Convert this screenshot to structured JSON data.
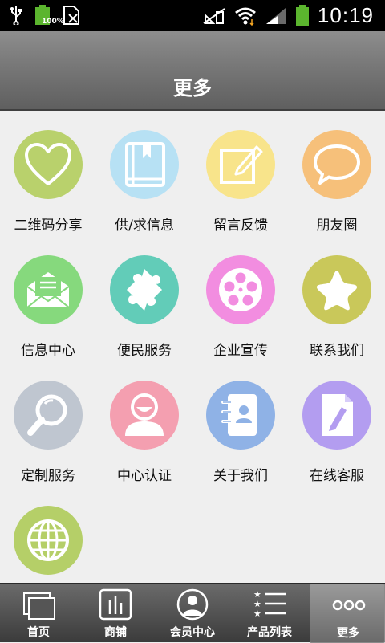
{
  "status_bar": {
    "time": "10:19",
    "battery_level_label": "100%"
  },
  "header": {
    "title": "更多"
  },
  "tiles": [
    {
      "label": "二维码分享",
      "icon": "heart-icon",
      "color": "#b9d16c"
    },
    {
      "label": "供/求信息",
      "icon": "book-icon",
      "color": "#b7e1f4"
    },
    {
      "label": "留言反馈",
      "icon": "edit-icon",
      "color": "#f8e48b"
    },
    {
      "label": "朋友圈",
      "icon": "chat-bubble-icon",
      "color": "#f6c07a"
    },
    {
      "label": "信息中心",
      "icon": "envelope-icon",
      "color": "#86d97d"
    },
    {
      "label": "便民服务",
      "icon": "puzzle-icon",
      "color": "#62ccb8"
    },
    {
      "label": "企业宣传",
      "icon": "film-reel-icon",
      "color": "#f28de0"
    },
    {
      "label": "联系我们",
      "icon": "star-icon",
      "color": "#c9c85a"
    },
    {
      "label": "定制服务",
      "icon": "magnifier-icon",
      "color": "#bfc6d0"
    },
    {
      "label": "中心认证",
      "icon": "user-icon",
      "color": "#f49fb0"
    },
    {
      "label": "关于我们",
      "icon": "contacts-book-icon",
      "color": "#8fb2e6"
    },
    {
      "label": "在线客服",
      "icon": "document-pen-icon",
      "color": "#b39df0"
    },
    {
      "label": "",
      "icon": "globe-icon",
      "color": "#b5cf68"
    }
  ],
  "tabbar": {
    "items": [
      {
        "label": "首页",
        "icon": "home-windows-icon"
      },
      {
        "label": "商铺",
        "icon": "shop-bars-icon"
      },
      {
        "label": "会员中心",
        "icon": "member-avatar-icon"
      },
      {
        "label": "产品列表",
        "icon": "list-stars-icon"
      },
      {
        "label": "更多",
        "icon": "more-dots-icon"
      }
    ],
    "active_index": 4
  }
}
